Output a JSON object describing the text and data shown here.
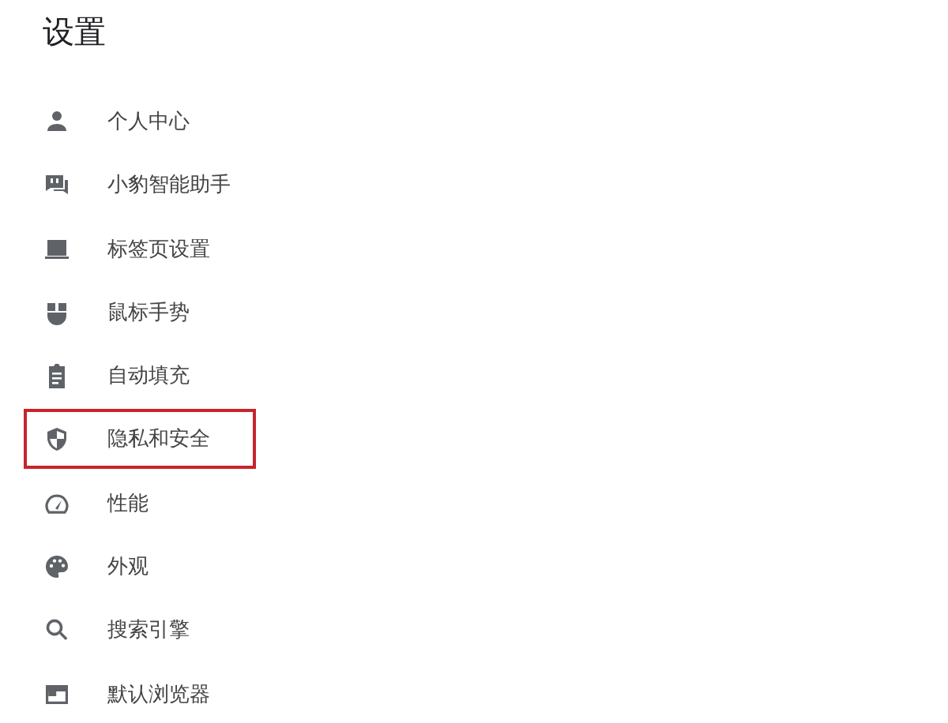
{
  "title": "设置",
  "menu": [
    {
      "label": "个人中心",
      "highlighted": false
    },
    {
      "label": "小豹智能助手",
      "highlighted": false
    },
    {
      "label": "标签页设置",
      "highlighted": false
    },
    {
      "label": "鼠标手势",
      "highlighted": false
    },
    {
      "label": "自动填充",
      "highlighted": false
    },
    {
      "label": "隐私和安全",
      "highlighted": true
    },
    {
      "label": "性能",
      "highlighted": false
    },
    {
      "label": "外观",
      "highlighted": false
    },
    {
      "label": "搜索引擎",
      "highlighted": false
    },
    {
      "label": "默认浏览器",
      "highlighted": false
    }
  ]
}
